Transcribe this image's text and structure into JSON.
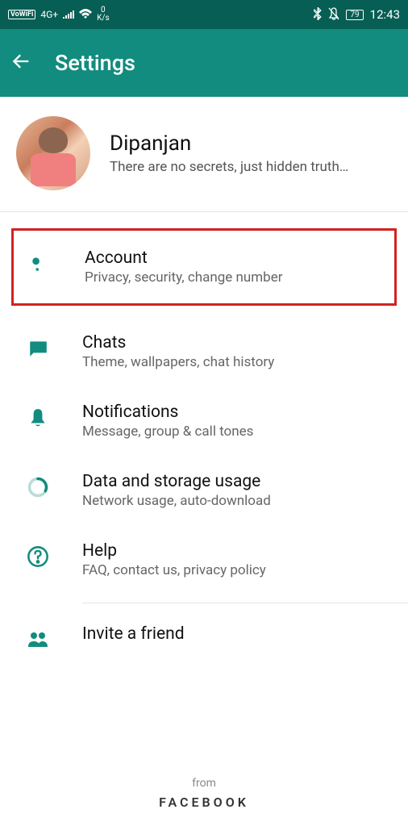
{
  "statusBar": {
    "vowifi": "VoWiFi",
    "signal": "4G+",
    "speed0": "0",
    "speedUnit": "K/s",
    "battery": "79",
    "time": "12:43"
  },
  "appBar": {
    "title": "Settings"
  },
  "profile": {
    "name": "Dipanjan",
    "status": "There are no secrets, just hidden truth…"
  },
  "menu": {
    "account": {
      "title": "Account",
      "subtitle": "Privacy, security, change number"
    },
    "chats": {
      "title": "Chats",
      "subtitle": "Theme, wallpapers, chat history"
    },
    "notifications": {
      "title": "Notifications",
      "subtitle": "Message, group & call tones"
    },
    "data": {
      "title": "Data and storage usage",
      "subtitle": "Network usage, auto-download"
    },
    "help": {
      "title": "Help",
      "subtitle": "FAQ, contact us, privacy policy"
    },
    "invite": {
      "title": "Invite a friend"
    }
  },
  "footer": {
    "from": "from",
    "brand": "FACEBOOK"
  }
}
